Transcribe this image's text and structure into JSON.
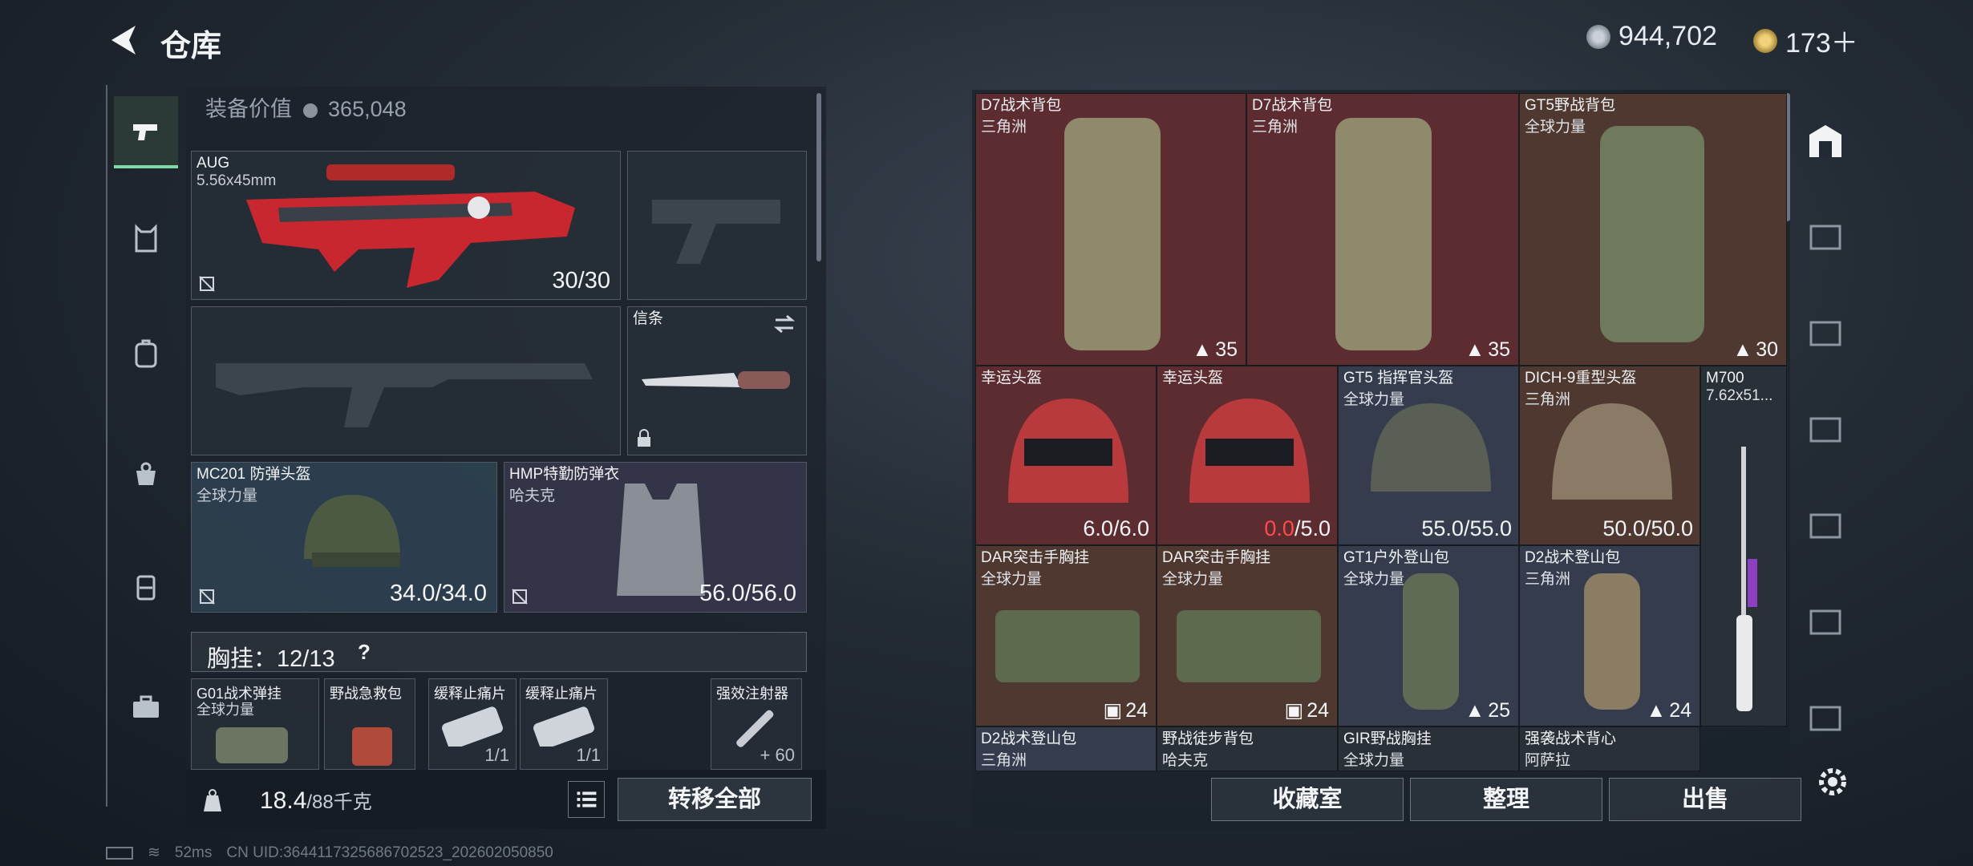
{
  "header": {
    "title": "仓库",
    "currency1": "944,702",
    "currency2": "173＋"
  },
  "equip_value": {
    "label": "装备价值",
    "value": "365,048"
  },
  "slots": {
    "primary": {
      "name": "AUG",
      "sub": "5.56x45mm",
      "value": "30/30"
    },
    "melee": {
      "name": "信条"
    },
    "helmet": {
      "name": "MC201 防弹头盔",
      "sub": "全球力量",
      "value": "34.0/34.0"
    },
    "armor": {
      "name": "HMP特勤防弹衣",
      "sub": "哈夫克",
      "value": "56.0/56.0"
    }
  },
  "rig": {
    "label": "胸挂：12/13",
    "help": "?",
    "items": [
      {
        "name": "G01战术弹挂",
        "sub": "全球力量",
        "qty": ""
      },
      {
        "name": "野战急救包",
        "sub": "",
        "qty": ""
      },
      {
        "name": "缓释止痛片",
        "sub": "",
        "qty": "1/1"
      },
      {
        "name": "缓释止痛片",
        "sub": "",
        "qty": "1/1"
      },
      {
        "name": "强效注射器",
        "sub": "",
        "qty": "60"
      }
    ]
  },
  "bottom": {
    "weight_value": "18.4",
    "weight_max": "/88千克",
    "transfer_label": "转移全部"
  },
  "grid": [
    {
      "name": "D7战术背包",
      "sub": "三角洲",
      "cap": "35"
    },
    {
      "name": "D7战术背包",
      "sub": "三角洲",
      "cap": "35"
    },
    {
      "name": "GT5野战背包",
      "sub": "全球力量",
      "cap": "30"
    },
    {
      "name": "幸运头盔",
      "sub": "",
      "v1": "6.0",
      "v2": "/6.0"
    },
    {
      "name": "幸运头盔",
      "sub": "",
      "v1": "0.0",
      "v2": "/5.0"
    },
    {
      "name": "GT5 指挥官头盔",
      "sub": "全球力量",
      "v1": "55.0",
      "v2": "/55.0"
    },
    {
      "name": "DICH-9重型头盔",
      "sub": "三角洲",
      "v1": "50.0",
      "v2": "/50.0"
    },
    {
      "name": "M700",
      "sub": "7.62x51..."
    },
    {
      "name": "DAR突击手胸挂",
      "sub": "全球力量",
      "cap": "24"
    },
    {
      "name": "DAR突击手胸挂",
      "sub": "全球力量",
      "cap": "24"
    },
    {
      "name": "GT1户外登山包",
      "sub": "全球力量",
      "cap": "25"
    },
    {
      "name": "D2战术登山包",
      "sub": "三角洲",
      "cap": "24"
    },
    {
      "name": "D2战术登山包",
      "sub": "三角洲"
    },
    {
      "name": "野战徒步背包",
      "sub": "哈夫克"
    },
    {
      "name": "GIR野战胸挂",
      "sub": "全球力量"
    },
    {
      "name": "强袭战术背心",
      "sub": "阿萨拉"
    }
  ],
  "actions": {
    "a1": "收藏室",
    "a2": "整理",
    "a3": "出售"
  },
  "footer": {
    "ping": "52ms",
    "uid": "CN UID:3644117325686702523_202602050850"
  }
}
